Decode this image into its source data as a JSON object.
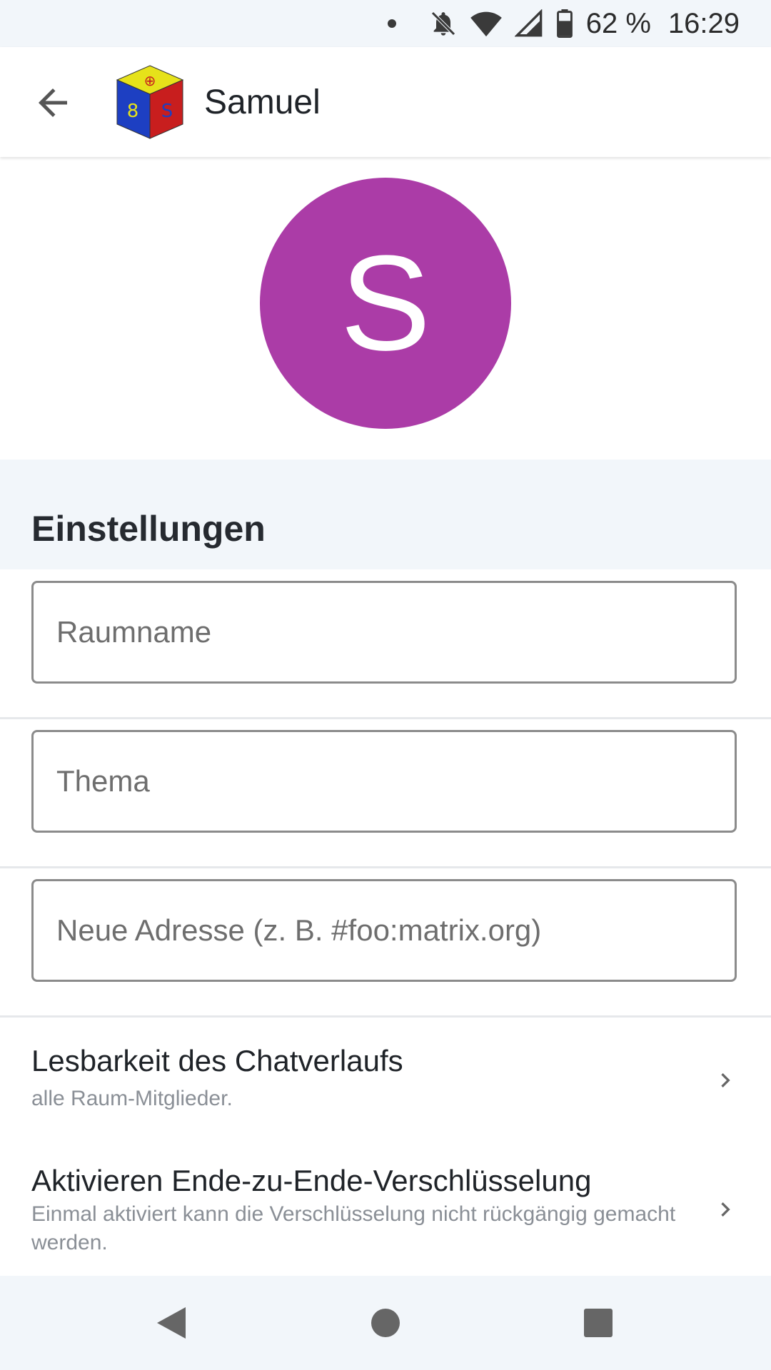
{
  "status_bar": {
    "battery": "62 %",
    "time": "16:29",
    "icons": [
      "notification-dot-icon",
      "bell-off-icon",
      "wifi-icon",
      "signal-icon",
      "battery-icon"
    ]
  },
  "app_bar": {
    "back_icon": "arrow-back-icon",
    "room_name": "Samuel"
  },
  "avatar": {
    "initial": "S",
    "color": "#ab3ca7"
  },
  "settings": {
    "section_title": "Einstellungen",
    "fields": {
      "room_name_placeholder": "Raumname",
      "topic_placeholder": "Thema",
      "address_placeholder": "Neue Adresse (z. B. #foo:matrix.org)"
    },
    "history_visibility": {
      "title": "Lesbarkeit des Chatverlaufs",
      "subtitle": "alle Raum-Mitglieder."
    },
    "encryption": {
      "title": "Aktivieren Ende-zu-Ende-Verschlüsselung",
      "subtitle": "Einmal aktiviert kann die Verschlüsselung nicht rückgängig gemacht werden."
    }
  },
  "navigation": {
    "icons": [
      "nav-back-icon",
      "nav-home-icon",
      "nav-recents-icon"
    ]
  }
}
